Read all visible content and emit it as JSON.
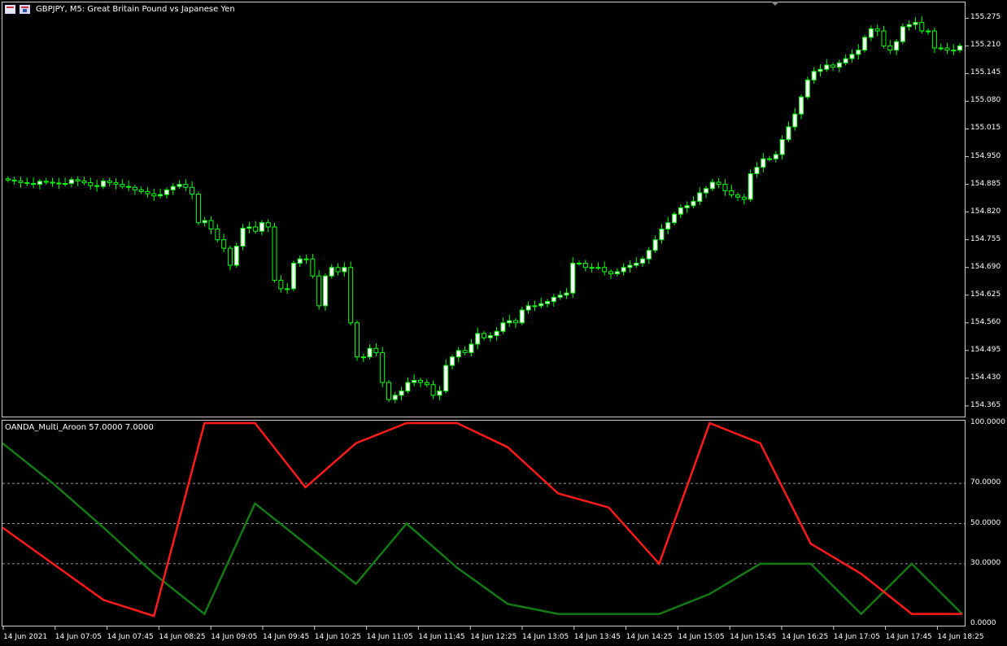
{
  "window": {
    "title": "GBPJPY, M5:  Great Britain Pound vs Japanese Yen",
    "indicator_title": "OANDA_Multi_Aroon 57.0000 7.0000",
    "icons": [
      "chart-window-icon",
      "symbol-flag-icon"
    ]
  },
  "price_axis": {
    "labels": [
      "155.275",
      "155.210",
      "155.145",
      "155.080",
      "155.015",
      "154.950",
      "154.885",
      "154.820",
      "154.755",
      "154.690",
      "154.625",
      "154.560",
      "154.495",
      "154.430",
      "154.365"
    ]
  },
  "indicator_axis": {
    "labels": [
      "100.0000",
      "70.0000",
      "50.0000",
      "30.0000",
      "0.0000"
    ]
  },
  "time_axis": {
    "labels": [
      "14 Jun 2021",
      "14 Jun 07:05",
      "14 Jun 07:45",
      "14 Jun 08:25",
      "14 Jun 09:05",
      "14 Jun 09:45",
      "14 Jun 10:25",
      "14 Jun 11:05",
      "14 Jun 11:45",
      "14 Jun 12:25",
      "14 Jun 13:05",
      "14 Jun 13:45",
      "14 Jun 14:25",
      "14 Jun 15:05",
      "14 Jun 15:45",
      "14 Jun 16:25",
      "14 Jun 17:05",
      "14 Jun 17:45",
      "14 Jun 18:25"
    ]
  },
  "colors": {
    "background": "#000000",
    "candle_bull_body": "#ffffff",
    "candle_outline": "#00ff00",
    "aroon_up": "#137a13",
    "aroon_down": "#ff1a1a",
    "level_lines": "#c8c8c8"
  },
  "chart_data": [
    {
      "type": "candlestick",
      "title": "GBPJPY, M5:  Great Britain Pound vs Japanese Yen",
      "ylim": [
        154.34,
        155.31
      ],
      "close_series": [
        154.895,
        154.893,
        154.889,
        154.887,
        154.885,
        154.892,
        154.89,
        154.888,
        154.886,
        154.887,
        154.896,
        154.893,
        154.889,
        154.882,
        154.88,
        154.893,
        154.889,
        154.885,
        154.88,
        154.878,
        154.872,
        154.868,
        154.863,
        154.858,
        154.861,
        154.872,
        154.88,
        154.885,
        154.878,
        154.862,
        154.795,
        154.8,
        154.78,
        154.755,
        154.735,
        154.695,
        154.74,
        154.782,
        154.785,
        154.775,
        154.795,
        154.785,
        154.66,
        154.64,
        154.64,
        154.7,
        154.71,
        154.71,
        154.67,
        154.6,
        154.67,
        154.69,
        154.68,
        154.69,
        154.56,
        154.48,
        154.48,
        154.5,
        154.49,
        154.42,
        154.38,
        154.39,
        154.4,
        154.42,
        154.425,
        154.42,
        154.415,
        154.39,
        154.4,
        154.46,
        154.48,
        154.495,
        154.49,
        154.51,
        154.535,
        154.525,
        154.53,
        154.54,
        154.56,
        154.565,
        154.56,
        154.59,
        154.6,
        154.6,
        154.605,
        154.61,
        154.62,
        154.625,
        154.63,
        154.7,
        154.7,
        154.69,
        154.69,
        154.69,
        154.68,
        154.675,
        154.68,
        154.69,
        154.695,
        154.7,
        154.71,
        154.73,
        154.755,
        154.78,
        154.795,
        154.815,
        154.83,
        154.835,
        154.845,
        154.865,
        154.875,
        154.89,
        154.885,
        154.87,
        154.86,
        154.855,
        154.85,
        154.91,
        154.925,
        154.945,
        154.945,
        154.955,
        154.99,
        155.02,
        155.05,
        155.09,
        155.13,
        155.15,
        155.155,
        155.165,
        155.16,
        155.17,
        155.18,
        155.19,
        155.2,
        155.23,
        155.25,
        155.245,
        155.21,
        155.2,
        155.22,
        155.255,
        155.26,
        155.265,
        155.245,
        155.245,
        155.205,
        155.205,
        155.2,
        155.2,
        155.21
      ]
    },
    {
      "type": "line",
      "title": "OANDA_Multi_Aroon 57.0000 7.0000",
      "ylim": [
        0,
        100
      ],
      "levels": [
        30,
        50,
        70
      ],
      "x": [
        "14 Jun 2021",
        "14 Jun 07:05",
        "14 Jun 07:45",
        "14 Jun 08:25",
        "14 Jun 09:05",
        "14 Jun 09:45",
        "14 Jun 10:25",
        "14 Jun 11:05",
        "14 Jun 11:45",
        "14 Jun 12:25",
        "14 Jun 13:05",
        "14 Jun 13:45",
        "14 Jun 14:25",
        "14 Jun 15:05",
        "14 Jun 15:45",
        "14 Jun 16:25",
        "14 Jun 17:05",
        "14 Jun 17:45",
        "14 Jun 18:25"
      ],
      "series": [
        {
          "values": [
            90,
            70,
            48,
            25,
            5,
            60,
            40,
            20,
            50,
            28,
            10,
            5,
            5,
            5,
            15,
            30,
            30,
            5,
            30,
            5
          ]
        },
        {
          "values": [
            48,
            30,
            12,
            4,
            100,
            100,
            68,
            90,
            100,
            100,
            88,
            65,
            58,
            30,
            100,
            90,
            40,
            25,
            5,
            5
          ]
        }
      ]
    }
  ]
}
